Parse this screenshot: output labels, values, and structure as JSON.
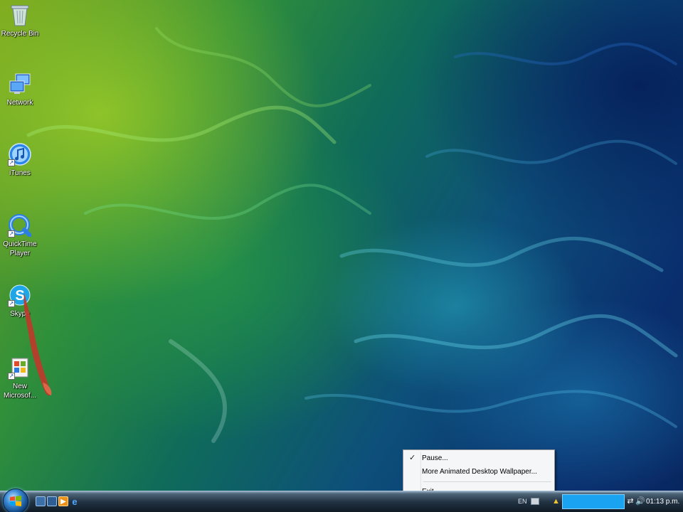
{
  "desktop": {
    "icons": [
      {
        "label_line1": "Recycle Bin",
        "label_line2": ""
      },
      {
        "label_line1": "Network",
        "label_line2": ""
      },
      {
        "label_line1": "iTunes",
        "label_line2": ""
      },
      {
        "label_line1": "QuickTime",
        "label_line2": "Player"
      },
      {
        "label_line1": "Skype",
        "label_line2": ""
      },
      {
        "label_line1": "New",
        "label_line2": "Microsof..."
      }
    ]
  },
  "context_menu": {
    "items": [
      {
        "label": "Pause...",
        "checked": true,
        "check_glyph": "✓"
      },
      {
        "label": "More Animated Desktop Wallpaper..."
      },
      {
        "label": "Exit"
      }
    ]
  },
  "taskbar": {
    "language": "EN",
    "clock": "01:13 p.m.",
    "quick_launch": [
      "show-desktop-icon",
      "switch-windows-icon",
      "media-player-icon",
      "internet-explorer-icon"
    ]
  },
  "colors": {
    "tray_highlight": "#1aa3f0",
    "menu_background": "#f5f6f7"
  }
}
